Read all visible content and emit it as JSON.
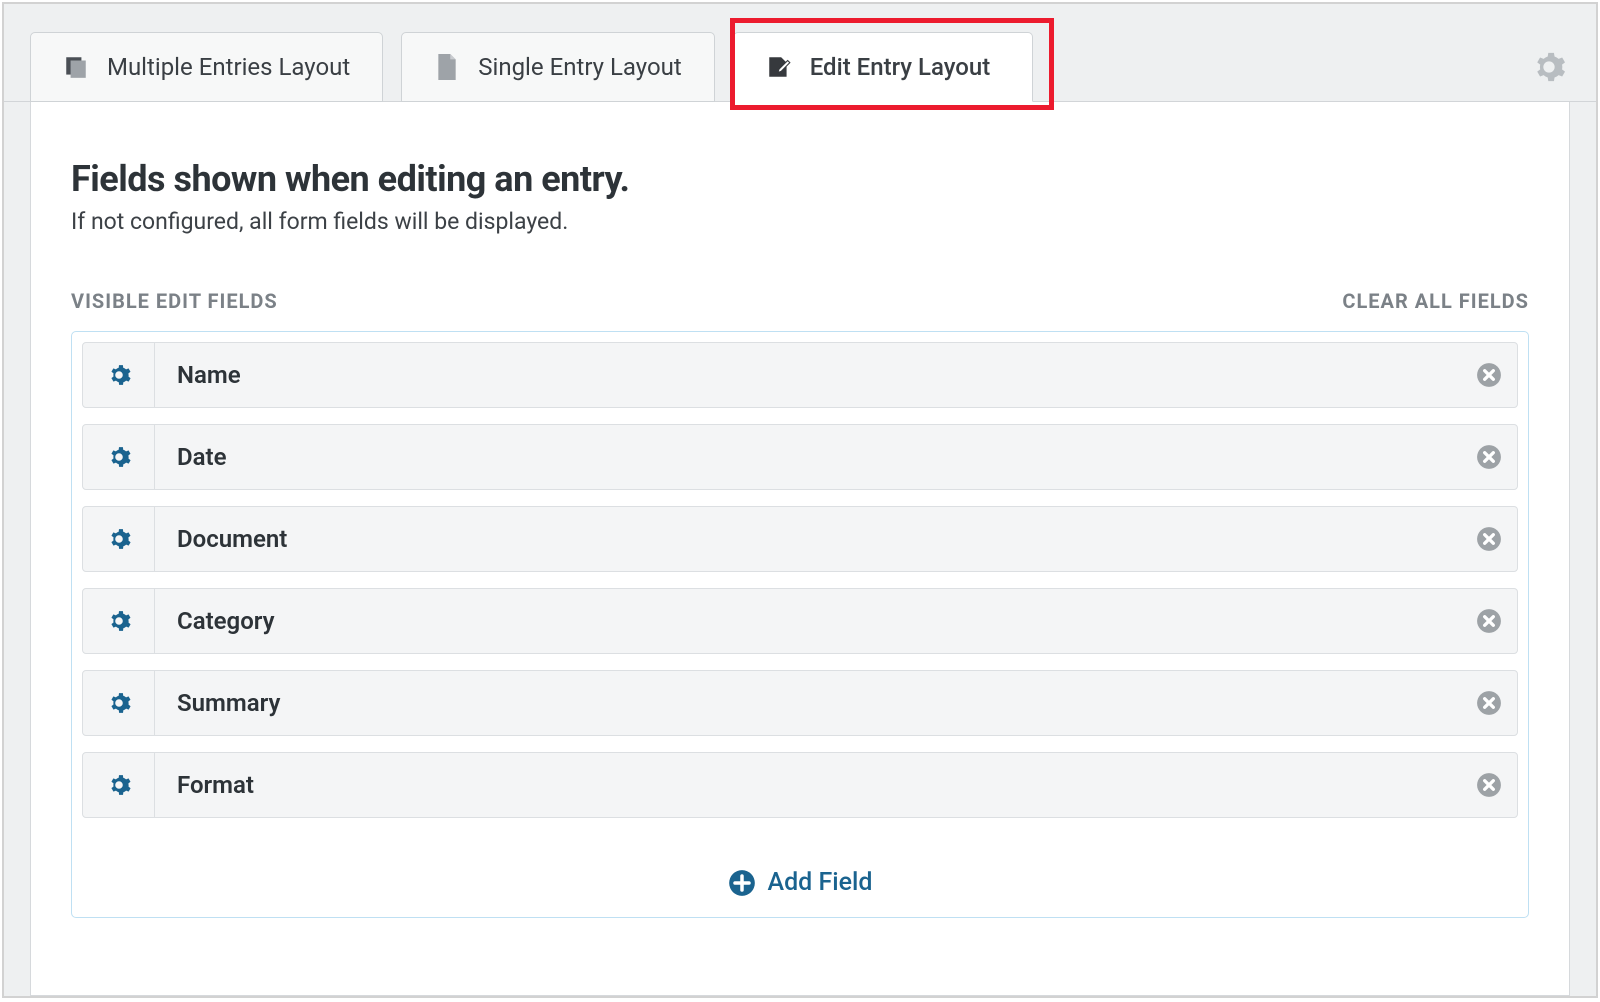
{
  "tabs": {
    "multiple": "Multiple Entries Layout",
    "single": "Single Entry Layout",
    "edit": "Edit Entry Layout"
  },
  "header": {
    "title": "Fields shown when editing an entry.",
    "subtitle": "If not configured, all form fields will be displayed."
  },
  "section": {
    "label": "VISIBLE EDIT FIELDS",
    "clear": "CLEAR ALL FIELDS"
  },
  "fields": [
    {
      "label": "Name"
    },
    {
      "label": "Date"
    },
    {
      "label": "Document"
    },
    {
      "label": "Category"
    },
    {
      "label": "Summary"
    },
    {
      "label": "Format"
    }
  ],
  "add_field_label": "Add Field"
}
